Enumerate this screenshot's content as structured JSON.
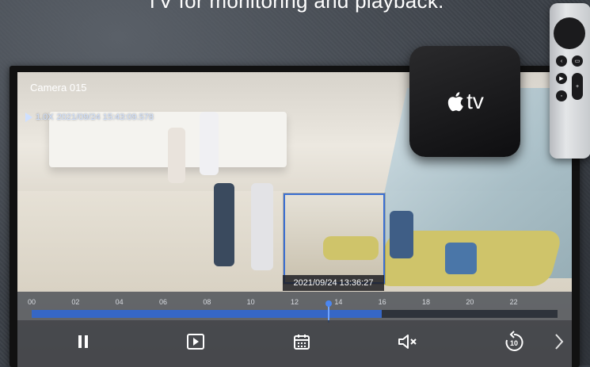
{
  "headline": "TV for monitoring and playback.",
  "camera": {
    "title": "Camera 015",
    "speed": "1.0X",
    "timestamp": "2021/09/24 15:43:09.578"
  },
  "preview": {
    "time": "2021/09/24 13:36:27"
  },
  "timeline": {
    "ticks": [
      "00",
      "02",
      "04",
      "06",
      "08",
      "10",
      "12",
      "14",
      "16",
      "18",
      "20",
      "22"
    ],
    "recorded_fraction": 0.665,
    "playhead_fraction": 0.564
  },
  "controls": {
    "pause": "pause-icon",
    "play": "play-icon",
    "calendar": "calendar-icon",
    "mute": "mute-icon",
    "replay": "replay-10-icon",
    "replay_label": "10",
    "next": "chevron-right-icon"
  },
  "device": {
    "label": "tv",
    "brand_icon": "apple-logo-icon"
  },
  "colors": {
    "accent": "#3667c6",
    "playhead": "#6fa4ff",
    "sofa": "#cfc46a"
  }
}
